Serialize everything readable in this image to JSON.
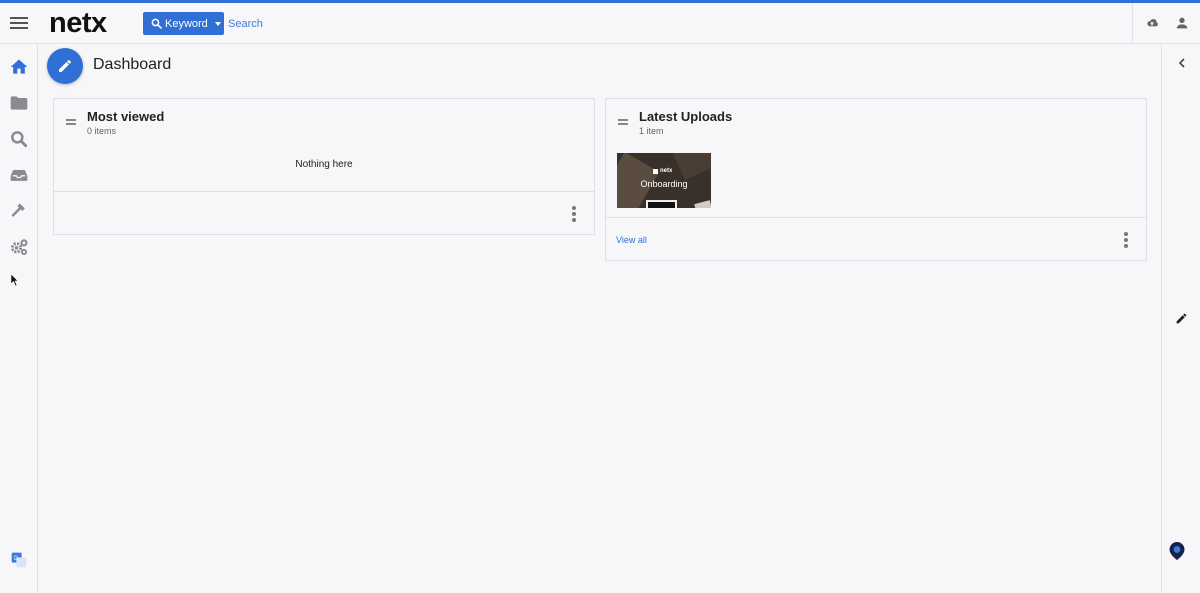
{
  "header": {
    "logo": "netx",
    "search_mode_label": "Keyword",
    "search_placeholder": "Search"
  },
  "sidebar": {
    "items": [
      {
        "name": "home-icon",
        "active": true
      },
      {
        "name": "folder-icon",
        "active": false
      },
      {
        "name": "search-icon",
        "active": false
      },
      {
        "name": "inbox-icon",
        "active": false
      },
      {
        "name": "hammer-icon",
        "active": false
      },
      {
        "name": "gears-icon",
        "active": false
      }
    ],
    "bottom_icon": "translate-icon"
  },
  "page": {
    "title": "Dashboard"
  },
  "cards": {
    "most_viewed": {
      "title": "Most viewed",
      "count": "0 items",
      "empty_text": "Nothing here"
    },
    "latest_uploads": {
      "title": "Latest Uploads",
      "count": "1 item",
      "thumbnail_brand": "netx",
      "thumbnail_label": "Onboarding",
      "view_all": "View all"
    }
  },
  "colors": {
    "accent": "#2f6fd6",
    "background": "#f7f6f9",
    "border": "#e0dfe4",
    "icon_grey": "#8a8a8f"
  }
}
